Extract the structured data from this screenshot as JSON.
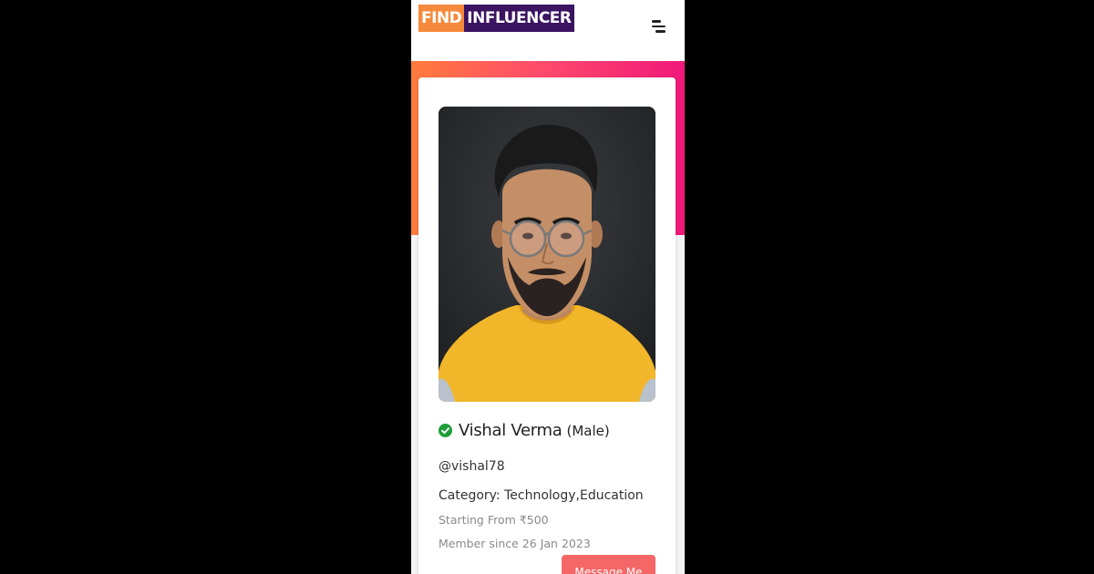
{
  "header": {
    "logo_part1": "FIND",
    "logo_part2": "INFLUENCER",
    "menu_icon": "hamburger-menu-icon"
  },
  "colors": {
    "logo_find_bg": "#f58a3c",
    "logo_influencer_bg": "#3b1361",
    "gradient_start": "#ff7b3c",
    "gradient_end": "#f0187a",
    "verified_green": "#1e9e3a",
    "button_bg": "#f56767"
  },
  "profile": {
    "verified_icon": "verified-check-icon",
    "name": "Vishal Verma",
    "gender": "(Male)",
    "handle": "@vishal78",
    "category": "Category: Technology,Education",
    "starting_from": "Starting From ₹500",
    "member_since": "Member since 26 Jan 2023",
    "message_button": "Message Me"
  }
}
